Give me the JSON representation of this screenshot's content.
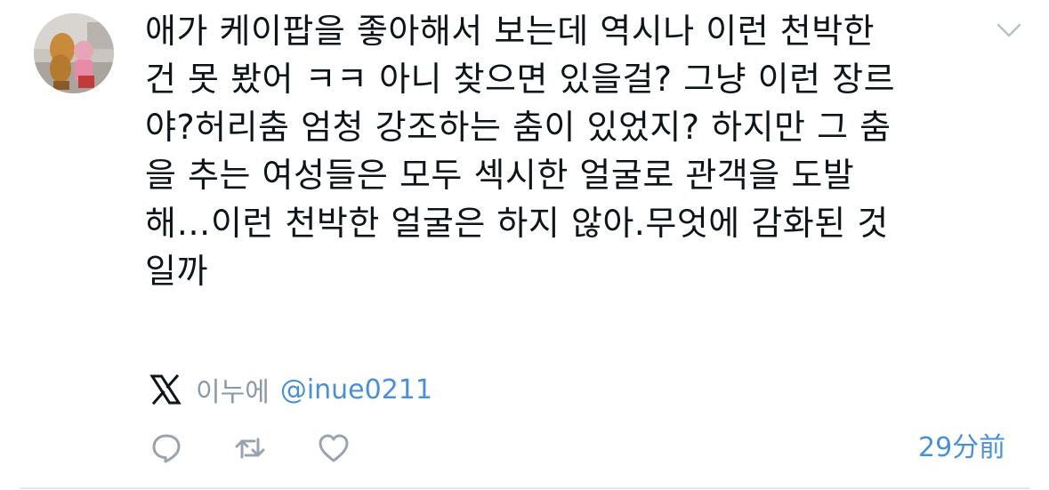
{
  "tweet": {
    "text": "애가 케이팝을 좋아해서 보는데 역시나 이런 천박한\n건 못 봤어 ㅋㅋ 아니 찾으면 있을걸? 그냥 이런 장르\n야?허리춤 엄청 강조하는 춤이 있었지? 하지만 그 춤\n을 추는 여성들은 모두 섹시한 얼굴로 관객을 도발\n해…이런 천박한 얼굴은 하지 않아.무엇에 감화된 것\n일까",
    "timestamp": "29分前"
  },
  "author": {
    "display_name": "이누에",
    "handle": "@inue0211"
  },
  "icons": {
    "platform": "x-logo-icon",
    "menu": "chevron-down-icon",
    "reply": "reply-icon",
    "retweet": "retweet-icon",
    "like": "heart-icon"
  },
  "colors": {
    "text": "#0f1419",
    "muted": "#8b98a5",
    "accent": "#4a90d9"
  }
}
